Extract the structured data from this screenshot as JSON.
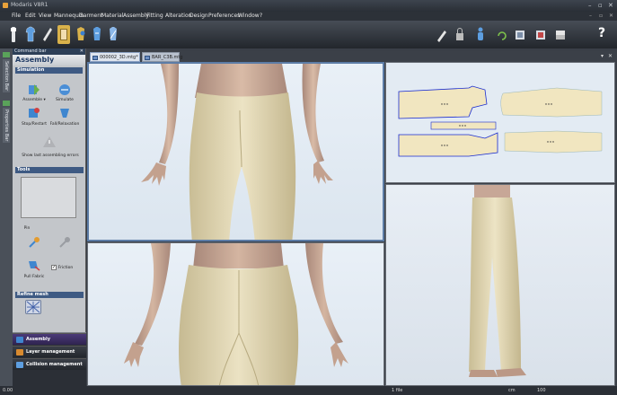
{
  "window": {
    "title": "Modaris V8R1"
  },
  "menu": [
    "File",
    "Edit",
    "View",
    "Mannequin",
    "Garment",
    "Material",
    "Assembly",
    "Fitting",
    "Alteration",
    "Design",
    "Preferences",
    "Window",
    "?"
  ],
  "toolbar": {
    "help": "?"
  },
  "left_strip": {
    "tab1": "Selection Bar",
    "tab2": "Properties Bar"
  },
  "panel": {
    "header": "Command bar",
    "title": "Assembly",
    "simulation_section": "Simulation",
    "assemble": "Assemble ▾",
    "simulate": "Simulate",
    "stop_restart": "Stop/Restart",
    "fall_relaxation": "Fall/Relaxation",
    "show_last_error": "Show last assembling errors",
    "tools_section": "Tools",
    "pin": "Pin",
    "pull_fabric": "Pull Fabric",
    "friction": "Friction",
    "refine_section": "Refine mesh"
  },
  "bottom_tabs": [
    {
      "label": "Assembly",
      "selected": true
    },
    {
      "label": "Layer management",
      "selected": false
    },
    {
      "label": "Collision management",
      "selected": false
    }
  ],
  "doc_tabs": [
    "000002_3D.mtg*",
    "BAR_C3B.mtg"
  ],
  "statusbar": {
    "left": "0.00",
    "mid": "1 file",
    "unit": "cm",
    "zoom": "100"
  },
  "colors": {
    "fabric": "#e8dfbf",
    "skin": "#c9ab97",
    "viewport_bg": "#e6eef6",
    "accent": "#3e5a83",
    "menu_bg": "#2c3138"
  }
}
